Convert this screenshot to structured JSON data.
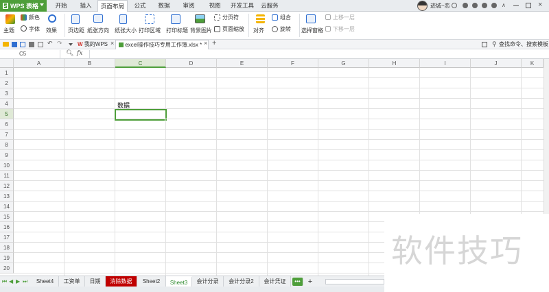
{
  "app": {
    "name": "WPS 表格"
  },
  "menu_tabs": [
    "开始",
    "插入",
    "页面布局",
    "公式",
    "数据",
    "审阅",
    "视图",
    "开发工具",
    "云服务"
  ],
  "active_menu_tab": "页面布局",
  "user": {
    "name": "迹城~恋"
  },
  "ribbon": {
    "theme": "主题",
    "colors": "颜色",
    "fonts": "字体",
    "effects": "效果",
    "margins": "页边距",
    "orientation": "纸张方向",
    "size": "纸张大小",
    "print_area": "打印区域",
    "print_titles": "打印标题",
    "background": "背景图片",
    "page_break": "分页符",
    "page_zoom": "页面缩放",
    "align": "对齐",
    "rotate": "旋转",
    "group": "组合",
    "selection_pane": "选择窗格",
    "bring_forward": "上移一层",
    "send_backward": "下移一层",
    "search": "查找命令、搜索模板"
  },
  "doc_tabs": [
    {
      "label": "我的WPS",
      "active": false
    },
    {
      "label": "excel操作技巧专用工作簿.xlsx *",
      "active": true
    }
  ],
  "formula_bar": {
    "name_box": "C5",
    "fx": "fx"
  },
  "columns": [
    "A",
    "B",
    "C",
    "D",
    "E",
    "F",
    "G",
    "H",
    "I",
    "J",
    "K"
  ],
  "rows": [
    1,
    2,
    3,
    4,
    5,
    6,
    7,
    8,
    9,
    10,
    11,
    12,
    13,
    14,
    15,
    16,
    17,
    18,
    19,
    20
  ],
  "selected": {
    "column": "C",
    "row": 5
  },
  "cells": {
    "C4": "数据"
  },
  "sheets": [
    "Sheet4",
    "工资单",
    "日期",
    "消除数据",
    "Sheet2",
    "Sheet3",
    "会计分录",
    "会计分录2",
    "会计凭证"
  ],
  "active_sheet": "Sheet3",
  "highlight_sheet": "消除数据",
  "sheet_more": "•••",
  "add_sheet": "+",
  "watermark": "软件技巧",
  "colors": {
    "accent": "#4e9e3a",
    "highlight_tab": "#c00000",
    "wps_red": "#d0342c"
  }
}
